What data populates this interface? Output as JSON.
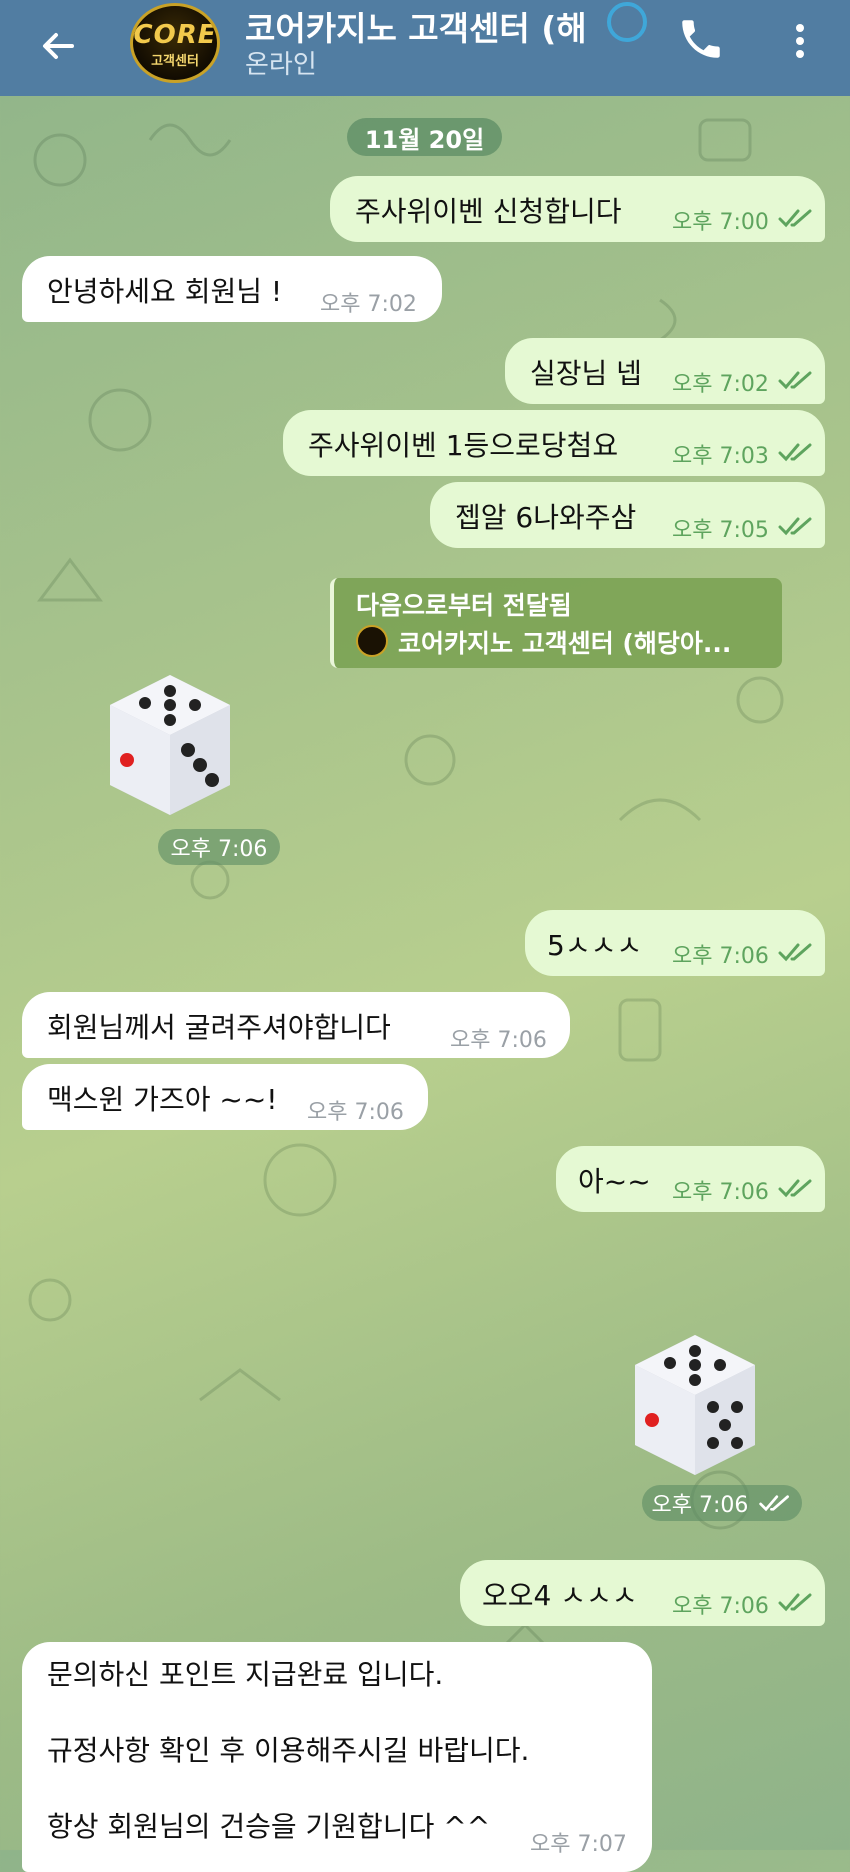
{
  "header": {
    "title": "코어카지노 고객센터 (해",
    "status": "온라인",
    "avatar_logo": "CORE",
    "avatar_sub": "고객센터"
  },
  "date": "11월 20일",
  "messages": [
    {
      "dir": "out",
      "text": "주사위이벤 신청합니다",
      "time": "오후 7:00"
    },
    {
      "dir": "in",
      "text": "안녕하세요 회원님 !",
      "time": "오후 7:02"
    },
    {
      "dir": "out",
      "text": "실장님 넵",
      "time": "오후 7:02"
    },
    {
      "dir": "out",
      "text": "주사위이벤 1등으로당첨요",
      "time": "오후 7:03"
    },
    {
      "dir": "out",
      "text": "젭알 6나와주삼",
      "time": "오후 7:05"
    },
    {
      "dir": "out",
      "text": "5ㅅㅅㅅ",
      "time": "오후 7:06"
    },
    {
      "dir": "in",
      "text": "회원님께서 굴려주셔야합니다",
      "time": "오후 7:06"
    },
    {
      "dir": "in",
      "text": "맥스윈 가즈아 ~~!",
      "time": "오후 7:06"
    },
    {
      "dir": "out",
      "text": "아~~",
      "time": "오후 7:06"
    },
    {
      "dir": "out",
      "text": "오오4 ㅅㅅㅅ",
      "time": "오후 7:06"
    }
  ],
  "forward": {
    "header": "다음으로부터 전달됨",
    "name": "코어카지노 고객센터 (해당아..."
  },
  "dice_in": {
    "value": 5,
    "time": "오후 7:06"
  },
  "dice_out": {
    "value": 5,
    "time": "오후 7:06"
  },
  "last_message": {
    "line1": "문의하신 포인트 지급완료 입니다.",
    "line2": "규정사항 확인 후 이용해주시길 바랍니다.",
    "line3": "항상 회원님의 건승을 기원합니다 ^^",
    "time": "오후 7:07"
  },
  "colors": {
    "header_bg": "#517da2",
    "out_bubble": "#e5f9d3",
    "in_bubble": "#ffffff",
    "tick_green": "#5ea45e"
  }
}
